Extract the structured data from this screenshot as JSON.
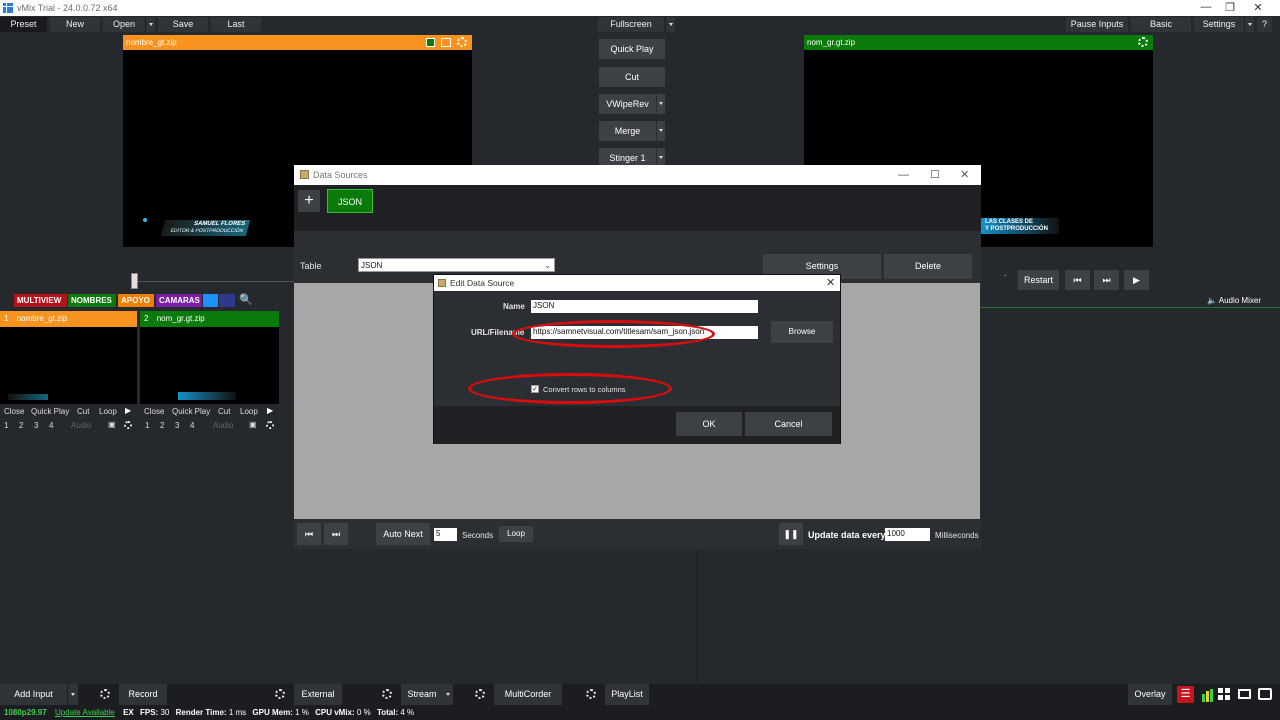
{
  "window": {
    "title": "vMix Trial - 24.0.0.72 x64"
  },
  "toolbar": {
    "preset": "Preset",
    "new": "New",
    "open": "Open",
    "save": "Save",
    "last": "Last",
    "fullscreen": "Fullscreen",
    "pause_inputs": "Pause Inputs",
    "basic": "Basic",
    "settings": "Settings",
    "help": "?"
  },
  "preview": {
    "name": "nombre_gt.zip",
    "lower_third_line1": "SAMUEL FLORES",
    "lower_third_line2": "EDITOR & POSTPRODUCCIÓN"
  },
  "output": {
    "name": "nom_gr.gt.zip",
    "lower_third_line1": "LAS CLASES DE",
    "lower_third_line2": "Y POSTPRODUCCIÓN"
  },
  "transitions": [
    "Quick Play",
    "Cut",
    "VWipeRev",
    "Merge",
    "Stinger 1"
  ],
  "playback": {
    "dot": ".",
    "restart": "Restart",
    "audio_mixer": "Audio Mixer"
  },
  "tabs": [
    {
      "label": "MULTIVIEW",
      "color": "#b5121b"
    },
    {
      "label": "NOMBRES",
      "color": "#0a7a0a"
    },
    {
      "label": "APOYO",
      "color": "#f07e00"
    },
    {
      "label": "CAMARAS",
      "color": "#7b1fa2"
    },
    {
      "label": "",
      "color": "#1e90ff"
    },
    {
      "label": "",
      "color": "#2d3a8c"
    }
  ],
  "inputs": [
    {
      "number": "1",
      "name": "nombre_gt.zip",
      "color": "#f7931e"
    },
    {
      "number": "2",
      "name": "nom_gr.gt.zip",
      "color": "#0a7a0a"
    }
  ],
  "input_controls": {
    "close": "Close",
    "quick_play": "Quick Play",
    "cut": "Cut",
    "loop": "Loop",
    "n1": "1",
    "n2": "2",
    "n3": "3",
    "n4": "4",
    "audio": "Audio"
  },
  "data_sources": {
    "title": "Data Sources",
    "add": "+",
    "source_tab": "JSON",
    "table_label": "Table",
    "table_value": "JSON",
    "settings": "Settings",
    "delete": "Delete",
    "auto_next": "Auto Next",
    "seconds_value": "5",
    "seconds_label": "Seconds",
    "loop": "Loop",
    "update_label": "Update data every",
    "update_value": "1000",
    "milliseconds": "Milliseconds"
  },
  "edit_dialog": {
    "title": "Edit Data Source",
    "name_label": "Name",
    "name_value": "JSON",
    "url_label": "URL/Filename",
    "url_value": "https://samnetvisual.com/titlesam/sam_json.json",
    "browse": "Browse",
    "convert_label": "Convert rows to columns",
    "convert_checked": true,
    "ok": "OK",
    "cancel": "Cancel",
    "annotation_color": "#d90d0d"
  },
  "bottom": {
    "add_input": "Add Input",
    "record": "Record",
    "external": "External",
    "stream": "Stream",
    "multicorder": "MultiCorder",
    "playlist": "PlayList",
    "overlay": "Overlay"
  },
  "status": {
    "resolution": "1080p29.97",
    "update": "Update Available",
    "ex": "EX",
    "fps_label": "FPS:",
    "fps": "30",
    "render_label": "Render Time:",
    "render": "1 ms",
    "gpu_label": "GPU Mem:",
    "gpu": "1 %",
    "cpu_label": "CPU vMix:",
    "cpu": "0 %",
    "total_label": "Total:",
    "total": "4 %"
  }
}
